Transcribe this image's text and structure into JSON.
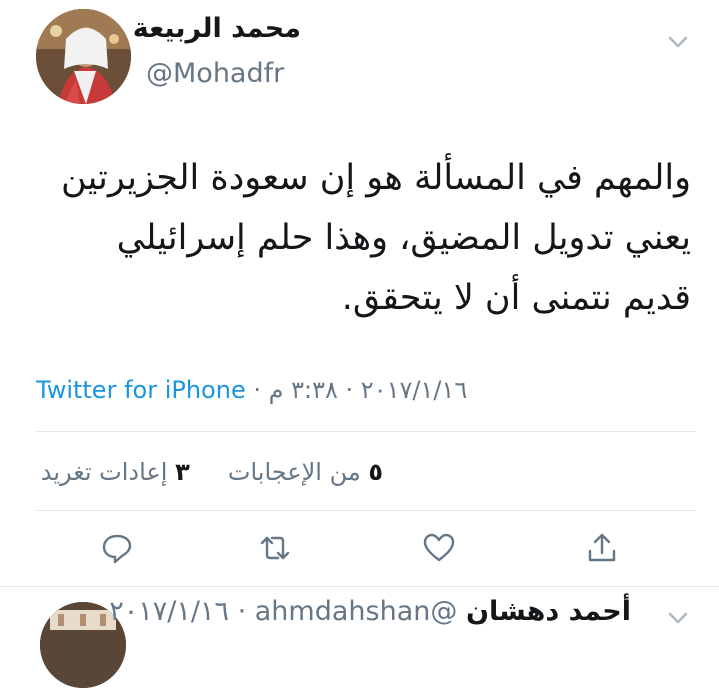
{
  "tweet": {
    "author_name": "محمد الربيعة",
    "author_handle": "@Mohadfr",
    "text_lines": [
      "والمهم في المسألة هو إن سعودة الجزيرتين",
      "يعني تدويل المضيق، وهذا حلم إسرائيلي",
      "قديم نتمنى أن لا يتحقق."
    ],
    "time": "٣:٣٨ م",
    "date": "٢٠١٧/١/١٦",
    "source": "Twitter for iPhone",
    "stats": {
      "likes_count": "٥",
      "likes_label": "من الإعجابات",
      "retweets_count": "٣",
      "retweets_label": "إعادات تغريد"
    }
  },
  "actions": [
    "reply-icon",
    "retweet-icon",
    "like-icon",
    "share-icon"
  ],
  "next_tweet": {
    "author_name": "أحمد دهشان",
    "handle_date": "@ahmdahshan · ٢٠١٧/١/١٦"
  },
  "colors": {
    "text": "#14171a",
    "secondary": "#657786",
    "link": "#1b95e0",
    "divider": "#e1e8ed"
  }
}
